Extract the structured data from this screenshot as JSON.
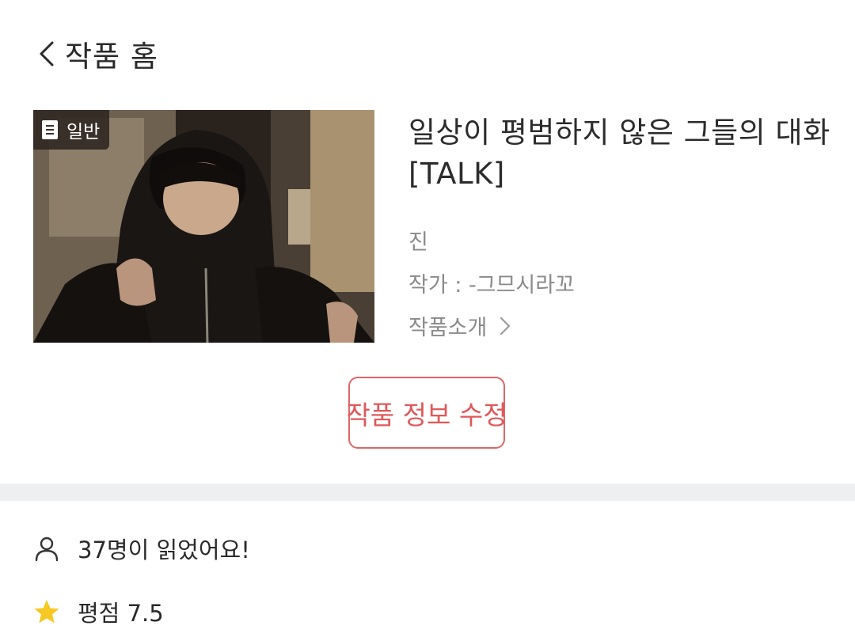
{
  "header": {
    "back_label": "작품 홈"
  },
  "work": {
    "genre_badge": "일반",
    "title_line1": "일상이 평범하지 않은 그들의 대화",
    "title_line2": "[TALK]",
    "subtitle": "진",
    "author": "작가 : -그므시라꼬",
    "intro_link": "작품소개"
  },
  "actions": {
    "edit_label": "작품 정보 수정"
  },
  "stats": {
    "readers_text": "37명이 읽었어요!",
    "rating_text": "평점 7.5"
  },
  "colors": {
    "accent": "#e16566",
    "divider": "#eeeff1",
    "star": "#f6c823",
    "muted_text": "#8a8a8a"
  },
  "icons": {
    "back": "chevron-left-icon",
    "badge": "document-icon",
    "intro": "chevron-right-icon",
    "readers": "person-icon",
    "rating": "star-icon"
  }
}
